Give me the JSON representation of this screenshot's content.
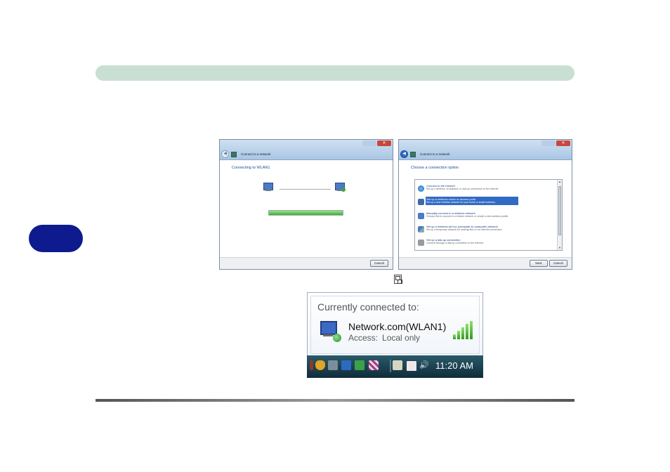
{
  "dialog1": {
    "title": "Connect to a network",
    "heading": "Connecting to WLAN1",
    "progress": 1.0,
    "cancel_label": "Cancel"
  },
  "dialog2": {
    "title": "Connect to a network",
    "heading": "Choose a connection option",
    "options": [
      {
        "label": "Connect to the Internet",
        "desc": "Set up a wireless, broadband, or dial-up connection to the Internet.",
        "icon": "globe-icon",
        "selected": false
      },
      {
        "label": "Set up a wireless router or access point",
        "desc": "Set up a new wireless network for your home or small business.",
        "icon": "router-icon",
        "selected": true
      },
      {
        "label": "Manually connect to a wireless network",
        "desc": "Choose this to connect to a hidden network or create a new wireless profile.",
        "icon": "wireless-pc-icon",
        "selected": false
      },
      {
        "label": "Set up a wireless ad hoc (computer-to-computer) network",
        "desc": "Set up a temporary network for sharing files or an Internet connection.",
        "icon": "adhoc-icon",
        "selected": false
      },
      {
        "label": "Set up a dial-up connection",
        "desc": "Connect through a dial-up connection to the Internet.",
        "icon": "phone-icon",
        "selected": false
      }
    ],
    "next_label": "Next",
    "cancel_label": "Cancel"
  },
  "popup": {
    "title": "Currently connected to:",
    "network_name": "Network.com(WLAN1)",
    "access_label": "Access:",
    "access_value": "Local only"
  },
  "taskbar": {
    "clock": "11:20 AM"
  },
  "colors": {
    "header_bar": "#c9dfd3",
    "side_tab": "#0d1b8e",
    "accent_blue": "#1c4d9c",
    "selection": "#316ac5"
  }
}
